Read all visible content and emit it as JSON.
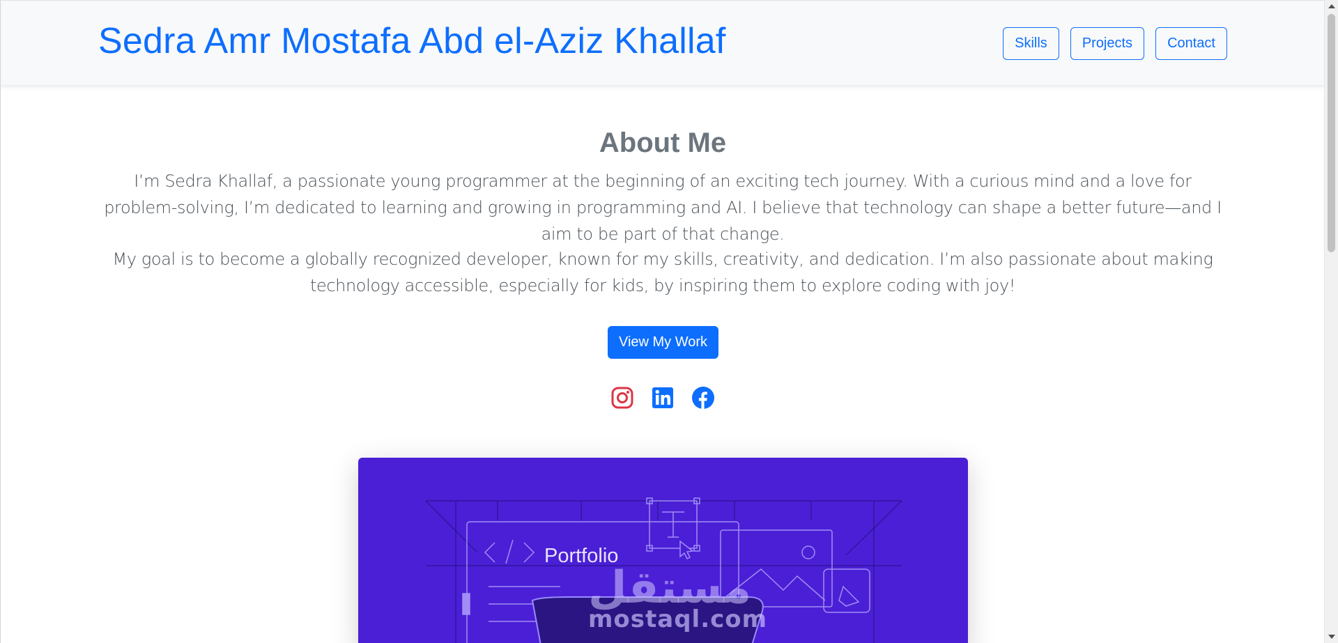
{
  "header": {
    "brand": "Sedra Amr Mostafa Abd el-Aziz Khallaf",
    "nav": [
      {
        "label": "Skills"
      },
      {
        "label": "Projects"
      },
      {
        "label": "Contact"
      }
    ]
  },
  "about": {
    "title": "About Me",
    "paragraph_1": "I’m Sedra Khallaf, a passionate young programmer at the beginning of an exciting tech journey. With a curious mind and a love for problem-solving, I’m dedicated to learning and growing in programming and AI. I believe that technology can shape a better future—and I aim to be part of that change.",
    "paragraph_2": "My goal is to become a globally recognized developer, known for my skills, creativity, and dedication. I’m also passionate about making technology accessible, especially for kids, by inspiring them to explore coding with joy!",
    "cta_label": "View My Work"
  },
  "socials": [
    {
      "icon": "instagram-icon",
      "color": "#dc3545"
    },
    {
      "icon": "linkedin-icon",
      "color": "#0d6efd"
    },
    {
      "icon": "facebook-icon",
      "color": "#0d6efd"
    }
  ],
  "hero_card": {
    "title": "Portfolio",
    "watermark_ar": "مستقل",
    "watermark": "mostaql.com",
    "background": "#4b1fd6"
  },
  "colors": {
    "primary": "#0d6efd",
    "heading_gray": "#6c757d",
    "text_gray": "#495057",
    "instagram": "#dc3545"
  }
}
